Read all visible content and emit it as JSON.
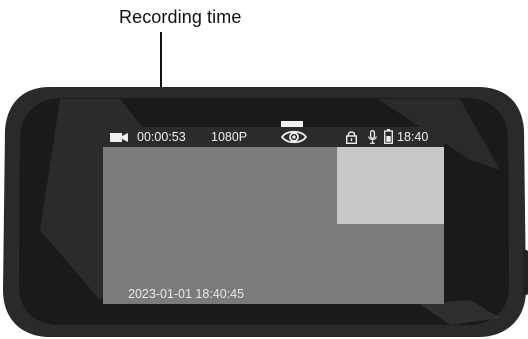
{
  "callout": {
    "label": "Recording time"
  },
  "status_bar": {
    "camera_icon": "video-camera-icon",
    "recording_time": "00:00:53",
    "resolution": "1080P",
    "view_icon": "eye-icon",
    "lock_icon": "lock-icon",
    "mic_icon": "microphone-icon",
    "battery_icon": "battery-icon",
    "clock": "18:40"
  },
  "overlay": {
    "datestamp": "2023-01-01   18:40:45"
  },
  "colors": {
    "status_bar_bg": "#2b2b2b",
    "screen_bg": "#7b7b7b",
    "pip_bg": "#c8c8c8",
    "bezel": "#1e1e1e"
  }
}
